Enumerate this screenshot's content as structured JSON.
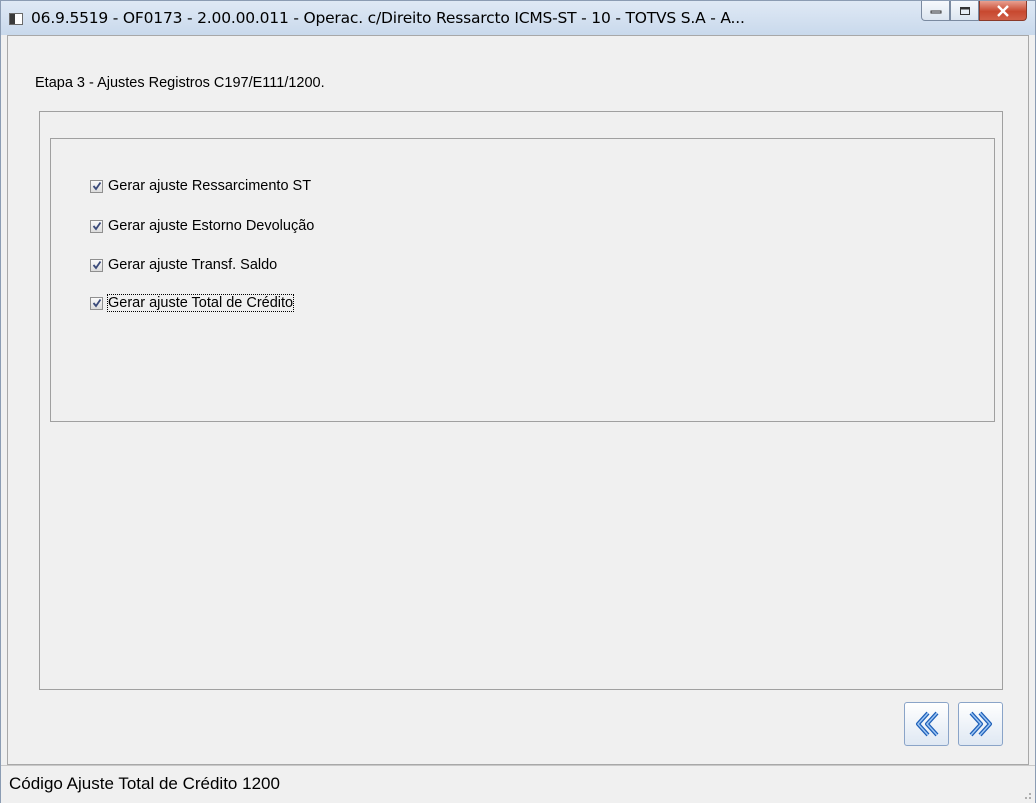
{
  "window": {
    "title": "06.9.5519 - OF0173 - 2.00.00.011 - Operac. c/Direito Ressarcto ICMS-ST - 10 - TOTVS S.A - A...",
    "icon": "app-window-icon",
    "controls": [
      "minimize-icon",
      "maximize-icon",
      "close-icon"
    ]
  },
  "step": {
    "label": "Etapa 3 - Ajustes Registros C197/E111/1200."
  },
  "options": [
    {
      "label": "Gerar ajuste Ressarcimento ST",
      "checked": true
    },
    {
      "label": "Gerar ajuste Estorno Devolução",
      "checked": true
    },
    {
      "label": "Gerar ajuste Transf. Saldo",
      "checked": true
    },
    {
      "label": "Gerar ajuste Total de Crédito",
      "checked": true
    }
  ],
  "navigation": {
    "back_icon": "double-chevron-left-icon",
    "next_icon": "double-chevron-right-icon"
  },
  "status": {
    "text": "Código Ajuste Total de Crédito 1200"
  }
}
